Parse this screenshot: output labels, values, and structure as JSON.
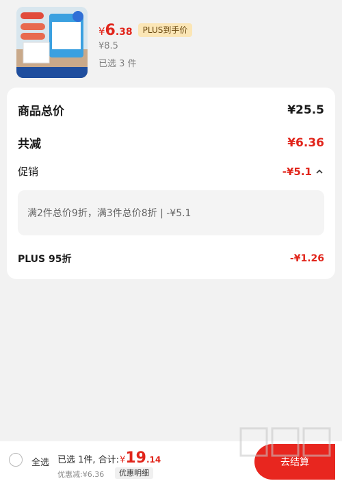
{
  "product": {
    "image_name": "product-thumbnail",
    "price_symbol": "¥",
    "price_int": "6",
    "price_dec": ".38",
    "plus_tag": "PLUS到手价",
    "original_price": "¥8.5",
    "selected_count": "已选 3 件"
  },
  "summary_card": {
    "total_label": "商品总价",
    "total_value": "¥25.5",
    "reduce_label": "共减",
    "reduce_value": "¥6.36",
    "promo_label": "促销",
    "promo_value": "-¥5.1",
    "promo_detail": "满2件总价9折，满3件总价8折 | -¥5.1",
    "plus_label": "PLUS 95折",
    "plus_value": "-¥1.26"
  },
  "bottom_bar": {
    "select_all": "全选",
    "summary_prefix": "已选 1件, 合计:",
    "sum_yen": "¥",
    "sum_int": "19",
    "sum_dec": ".14",
    "discount_line": "优惠减:¥6.36",
    "detail_button": "优惠明细",
    "checkout_button": "去结算"
  },
  "colors": {
    "accent_red": "#e1251b",
    "plus_gold": "#fbe6b6",
    "background": "#f2f2f2"
  }
}
